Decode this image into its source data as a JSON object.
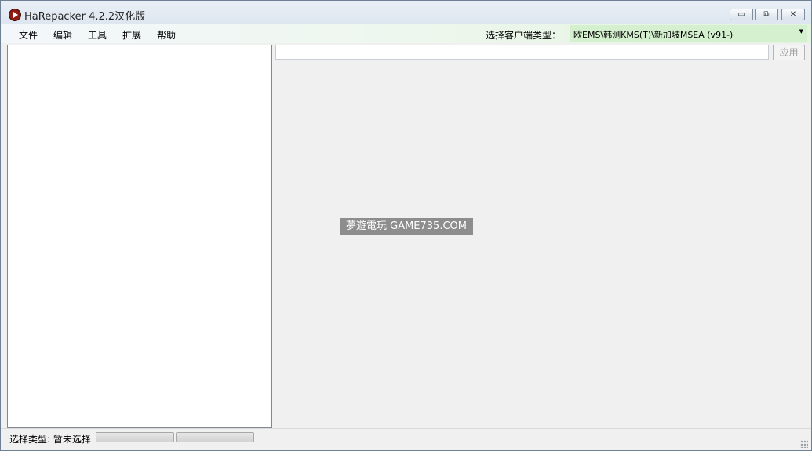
{
  "window": {
    "title": "HaRepacker 4.2.2汉化版",
    "controls": {
      "minimize": "▭",
      "maximize": "⧉",
      "close": "✕"
    }
  },
  "menu": {
    "items": [
      "文件",
      "编辑",
      "工具",
      "扩展",
      "帮助"
    ]
  },
  "client_type": {
    "label": "选择客户端类型：",
    "selected": "欧EMS\\韩测KMS(T)\\新加坡MSEA (v91-)",
    "arrow": "▼"
  },
  "editor": {
    "input_value": "",
    "apply_label": "应用"
  },
  "watermark": "夢遊電玩 GAME735.COM",
  "status": {
    "selection_text": "选择类型: 暂未选择",
    "progress1": 0,
    "progress2": 0
  }
}
